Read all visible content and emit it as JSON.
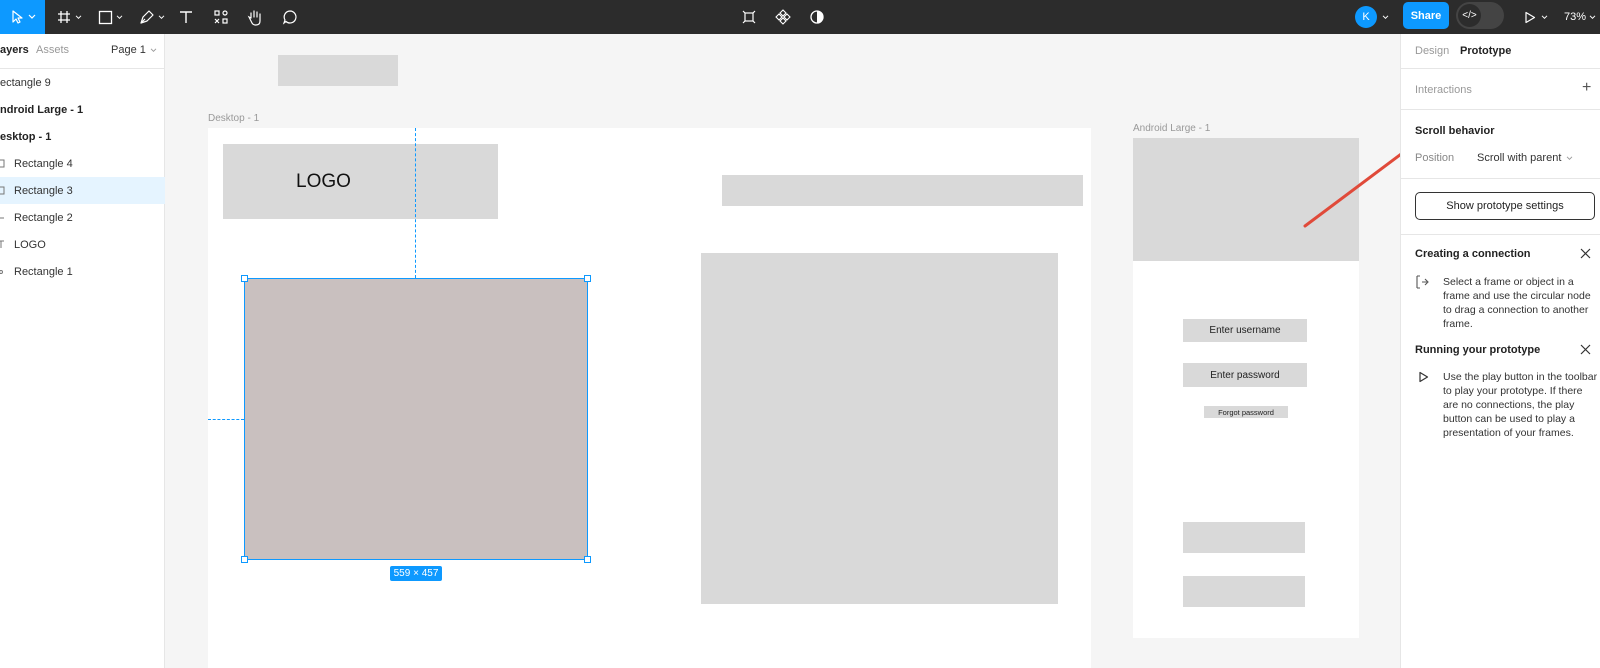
{
  "toolbar": {
    "move_tool": "move-tool",
    "share_label": "Share",
    "avatar_initial": "K",
    "zoom_label": "73%"
  },
  "sidebar": {
    "tabs": [
      "ayers",
      "Assets"
    ],
    "page_label": "Page 1",
    "layers": [
      {
        "label": "ectangle 9",
        "bold": false,
        "icon": ""
      },
      {
        "label": "ndroid Large - 1",
        "bold": true,
        "icon": ""
      },
      {
        "label": "esktop - 1",
        "bold": true,
        "icon": ""
      },
      {
        "label": "Rectangle 4",
        "bold": false,
        "icon": "rect"
      },
      {
        "label": "Rectangle 3",
        "bold": false,
        "icon": "rect"
      },
      {
        "label": "Rectangle 2",
        "bold": false,
        "icon": "line"
      },
      {
        "label": "LOGO",
        "bold": false,
        "icon": "text"
      },
      {
        "label": "Rectangle 1",
        "bold": false,
        "icon": "dot"
      }
    ],
    "selected_index": 4
  },
  "canvas": {
    "desktop_label": "Desktop - 1",
    "android_label": "Android Large - 1",
    "logo_text": "LOGO",
    "selection_size": "559 × 457",
    "username_label": "Enter username",
    "password_label": "Enter password",
    "forgot_label": "Forgot password",
    "selected_fill": "#c9c0bf",
    "selection_color": "#0d99ff",
    "arrow_color": "#e04a3a"
  },
  "right_panel": {
    "tabs": [
      "Design",
      "Prototype"
    ],
    "active_tab": "Prototype",
    "interactions_label": "Interactions",
    "scroll_behavior_title": "Scroll behavior",
    "position_label": "Position",
    "position_value": "Scroll with parent",
    "show_settings_label": "Show prototype settings",
    "creating_title": "Creating a connection",
    "creating_body": "Select a frame or object in a frame and use the circular node to drag a connection to another frame.",
    "running_title": "Running your prototype",
    "running_body": "Use the play button in the toolbar to play your prototype. If there are no connections, the play button can be used to play a presentation of your frames."
  }
}
